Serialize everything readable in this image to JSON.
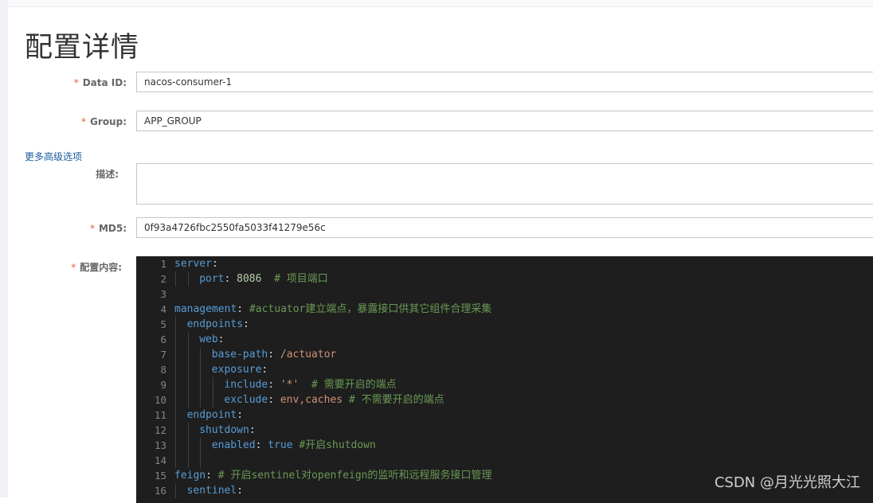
{
  "page": {
    "title": "配置详情"
  },
  "form": {
    "data_id": {
      "label": "Data ID:",
      "required": true,
      "value": "nacos-consumer-1"
    },
    "group": {
      "label": "Group:",
      "required": true,
      "value": "APP_GROUP"
    },
    "advanced_link": "更多高级选项",
    "description": {
      "label": "描述:",
      "required": false,
      "value": ""
    },
    "md5": {
      "label": "MD5:",
      "required": true,
      "value": "0f93a4726fbc2550fa5033f41279e56c"
    },
    "content": {
      "label": "配置内容:",
      "required": true
    }
  },
  "required_mark": "*",
  "editor": {
    "theme": {
      "background": "#1e1e1e",
      "key": "#569cd6",
      "comment": "#6a9955",
      "number": "#b5cea8",
      "string": "#ce9178"
    },
    "lines": [
      {
        "n": "1",
        "indent": 0,
        "tokens": [
          [
            "key",
            "server"
          ],
          [
            "punct",
            ":"
          ]
        ]
      },
      {
        "n": "2",
        "indent": 2,
        "tokens": [
          [
            "key",
            "port"
          ],
          [
            "punct",
            ": "
          ],
          [
            "num",
            "8086"
          ],
          [
            "punct",
            "  "
          ],
          [
            "comment",
            "# 项目端口"
          ]
        ]
      },
      {
        "n": "3",
        "indent": 0,
        "tokens": []
      },
      {
        "n": "4",
        "indent": 0,
        "tokens": [
          [
            "key",
            "management"
          ],
          [
            "punct",
            ": "
          ],
          [
            "comment",
            "#actuator建立端点，暴露接口供其它组件合理采集"
          ]
        ]
      },
      {
        "n": "5",
        "indent": 1,
        "tokens": [
          [
            "key",
            "endpoints"
          ],
          [
            "punct",
            ":"
          ]
        ]
      },
      {
        "n": "6",
        "indent": 2,
        "tokens": [
          [
            "key",
            "web"
          ],
          [
            "punct",
            ":"
          ]
        ]
      },
      {
        "n": "7",
        "indent": 3,
        "tokens": [
          [
            "key",
            "base-path"
          ],
          [
            "punct",
            ": "
          ],
          [
            "str",
            "/actuator"
          ]
        ]
      },
      {
        "n": "8",
        "indent": 3,
        "tokens": [
          [
            "key",
            "exposure"
          ],
          [
            "punct",
            ":"
          ]
        ]
      },
      {
        "n": "9",
        "indent": 4,
        "tokens": [
          [
            "key",
            "include"
          ],
          [
            "punct",
            ": "
          ],
          [
            "str",
            "'*'"
          ],
          [
            "punct",
            "  "
          ],
          [
            "comment",
            "# 需要开启的端点"
          ]
        ]
      },
      {
        "n": "10",
        "indent": 4,
        "tokens": [
          [
            "key",
            "exclude"
          ],
          [
            "punct",
            ": "
          ],
          [
            "str",
            "env,caches"
          ],
          [
            "punct",
            " "
          ],
          [
            "comment",
            "# 不需要开启的端点"
          ]
        ]
      },
      {
        "n": "11",
        "indent": 1,
        "tokens": [
          [
            "key",
            "endpoint"
          ],
          [
            "punct",
            ":"
          ]
        ]
      },
      {
        "n": "12",
        "indent": 2,
        "tokens": [
          [
            "key",
            "shutdown"
          ],
          [
            "punct",
            ":"
          ]
        ]
      },
      {
        "n": "13",
        "indent": 3,
        "tokens": [
          [
            "key",
            "enabled"
          ],
          [
            "punct",
            ": "
          ],
          [
            "kw",
            "true"
          ],
          [
            "punct",
            " "
          ],
          [
            "comment",
            "#开启shutdown"
          ]
        ]
      },
      {
        "n": "14",
        "indent": 0,
        "tokens": [],
        "guides": 3
      },
      {
        "n": "15",
        "indent": 0,
        "tokens": [
          [
            "key",
            "feign"
          ],
          [
            "punct",
            ": "
          ],
          [
            "comment",
            "# 开启sentinel对openfeign的监听和远程服务接口管理"
          ]
        ]
      },
      {
        "n": "16",
        "indent": 1,
        "tokens": [
          [
            "key",
            "sentinel"
          ],
          [
            "punct",
            ":"
          ]
        ]
      }
    ]
  },
  "watermark": "CSDN @月光光照大江"
}
